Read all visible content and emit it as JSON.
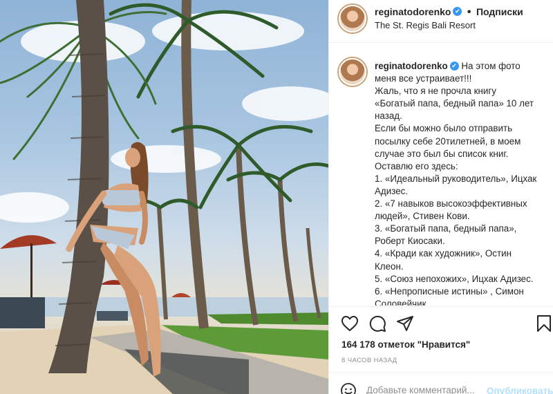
{
  "header": {
    "username": "reginatodorenko",
    "dot": "•",
    "follow_label": "Подписки",
    "location": "The St. Regis Bali Resort",
    "verified_icon": "✔"
  },
  "caption": {
    "username": "reginatodorenko",
    "lines": [
      "На этом фото",
      "меня все устраивает!!!",
      "Жаль, что я не прочла книгу",
      "«Богатый папа, бедный папа» 10 лет",
      "назад.",
      "Если бы можно было отправить",
      "посылку себе 20тилетней, в моем",
      "случае это был бы список книг.",
      "Оставлю его здесь:",
      "1. «Идеальный руководитель», Ицхак",
      "Адизес.",
      "2. «7 навыков высокоэффективных",
      "людей», Стивен Кови.",
      "3. «Богатый папа, бедный папа»,",
      "Роберт Киосаки.",
      "4. «Кради как художник», Остин",
      "Клеон.",
      "5. «Союз непохожих», Ицхак Адизес.",
      "6. «Непрописные истины» , Симон",
      "Соловейчик"
    ]
  },
  "actions": {
    "icons": [
      "heart-icon",
      "comment-icon",
      "share-icon",
      "bookmark-icon"
    ]
  },
  "likes": "164 178 отметок \"Нравится\"",
  "time_ago": "8 ЧАСОВ НАЗАД",
  "comment": {
    "placeholder": "Добавьте комментарий...",
    "publish_label": "Опубликовать"
  },
  "colors": {
    "verified": "#3897f0",
    "publish_disabled": "#b2dffc",
    "text": "#262626",
    "muted": "#8e8e8e"
  }
}
